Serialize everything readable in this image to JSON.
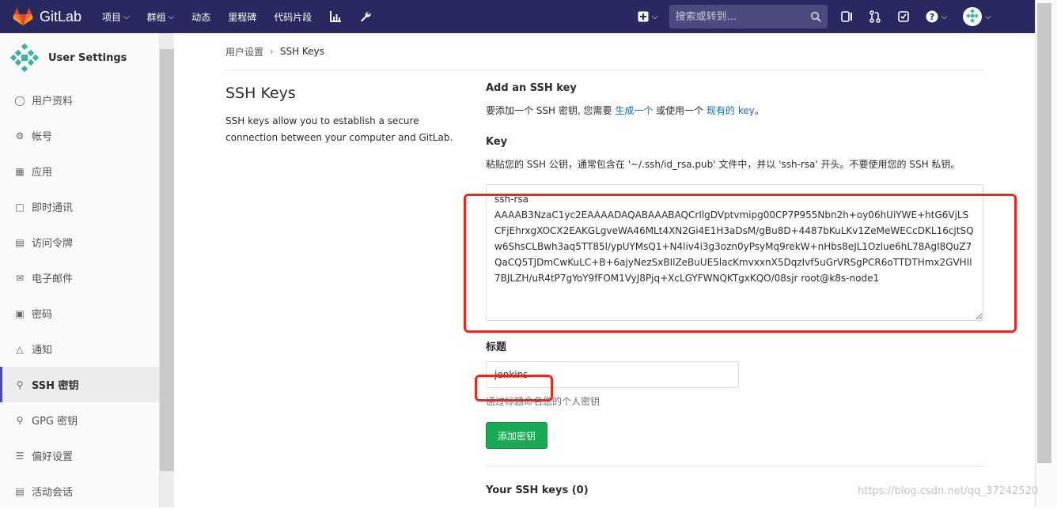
{
  "app": {
    "name": "GitLab"
  },
  "nav": {
    "items": [
      {
        "label": "项目",
        "caret": true
      },
      {
        "label": "群组",
        "caret": true
      },
      {
        "label": "动态",
        "caret": false
      },
      {
        "label": "里程碑",
        "caret": false
      },
      {
        "label": "代码片段",
        "caret": false
      }
    ],
    "search_placeholder": "搜索或转到..."
  },
  "sidebar": {
    "title": "User Settings",
    "items": [
      {
        "label": "用户资料",
        "icon": "user-icon"
      },
      {
        "label": "帐号",
        "icon": "account-gear-icon"
      },
      {
        "label": "应用",
        "icon": "applications-grid-icon"
      },
      {
        "label": "即时通讯",
        "icon": "chat-icon"
      },
      {
        "label": "访问令牌",
        "icon": "token-icon"
      },
      {
        "label": "电子邮件",
        "icon": "envelope-icon"
      },
      {
        "label": "密码",
        "icon": "lock-icon"
      },
      {
        "label": "通知",
        "icon": "bell-icon"
      },
      {
        "label": "SSH 密钥",
        "icon": "key-icon",
        "active": true
      },
      {
        "label": "GPG 密钥",
        "icon": "key-icon"
      },
      {
        "label": "偏好设置",
        "icon": "sliders-icon"
      },
      {
        "label": "活动会话",
        "icon": "session-icon"
      }
    ]
  },
  "breadcrumb": {
    "parent": "用户设置",
    "current": "SSH Keys"
  },
  "page": {
    "title": "SSH Keys",
    "description": "SSH keys allow you to establish a secure connection between your computer and GitLab."
  },
  "form": {
    "add_heading": "Add an SSH key",
    "intro_prefix": "要添加一个 SSH 密钥, 您需要 ",
    "intro_link1": "生成一个",
    "intro_mid": " 或使用一个 ",
    "intro_link2": "现有的 key",
    "intro_suffix": "。",
    "key_label": "Key",
    "key_hint": "粘贴您的 SSH 公钥，通常包含在 '~/.ssh/id_rsa.pub' 文件中，并以 'ssh-rsa' 开头。不要使用您的 SSH 私钥。",
    "key_value": "ssh-rsa\nAAAAB3NzaC1yc2EAAAADAQABAAABAQCrIlgDVptvmipg00CP7P955Nbn2h+oy06hUiYWE+htG6VjLSCFjEhrxgXOCX2EAKGLgveWA46MLt4XN2Gi4E1H3aDsM/gBu8D+4487bKuLKv1ZeMeWECcDKL16cjtSQw6ShsCLBwh3aq5TT85l/ypUYMsQ1+N4liv4i3g3ozn0yPsyMq9rekW+nHbs8eJL1Ozlue6hL78AgI8QuZ7QaCQ5TJDmCwKuLC+B+6ajyNezSxBIlZeBuUE5lacKmvxxnX5DqzIvf5uGrVRSgPCR6oTTDTHmx2GVHIl7BJLZH/uR4tP7gYoY9fFOM1VyJ8Pjq+XcLGYFWNQKTgxKQO/08sjr root@k8s-node1",
    "title_label": "标题",
    "title_value": "jenkins",
    "title_help": "通过标题命名您的个人密钥",
    "submit_label": "添加密钥",
    "your_keys": "Your SSH keys (0)"
  },
  "watermark": "https://blog.csdn.net/qq_37242520",
  "colors": {
    "navbar": "#292961",
    "accent": "#1aaa55",
    "link": "#1b69b6",
    "highlight": "#e8281e"
  }
}
